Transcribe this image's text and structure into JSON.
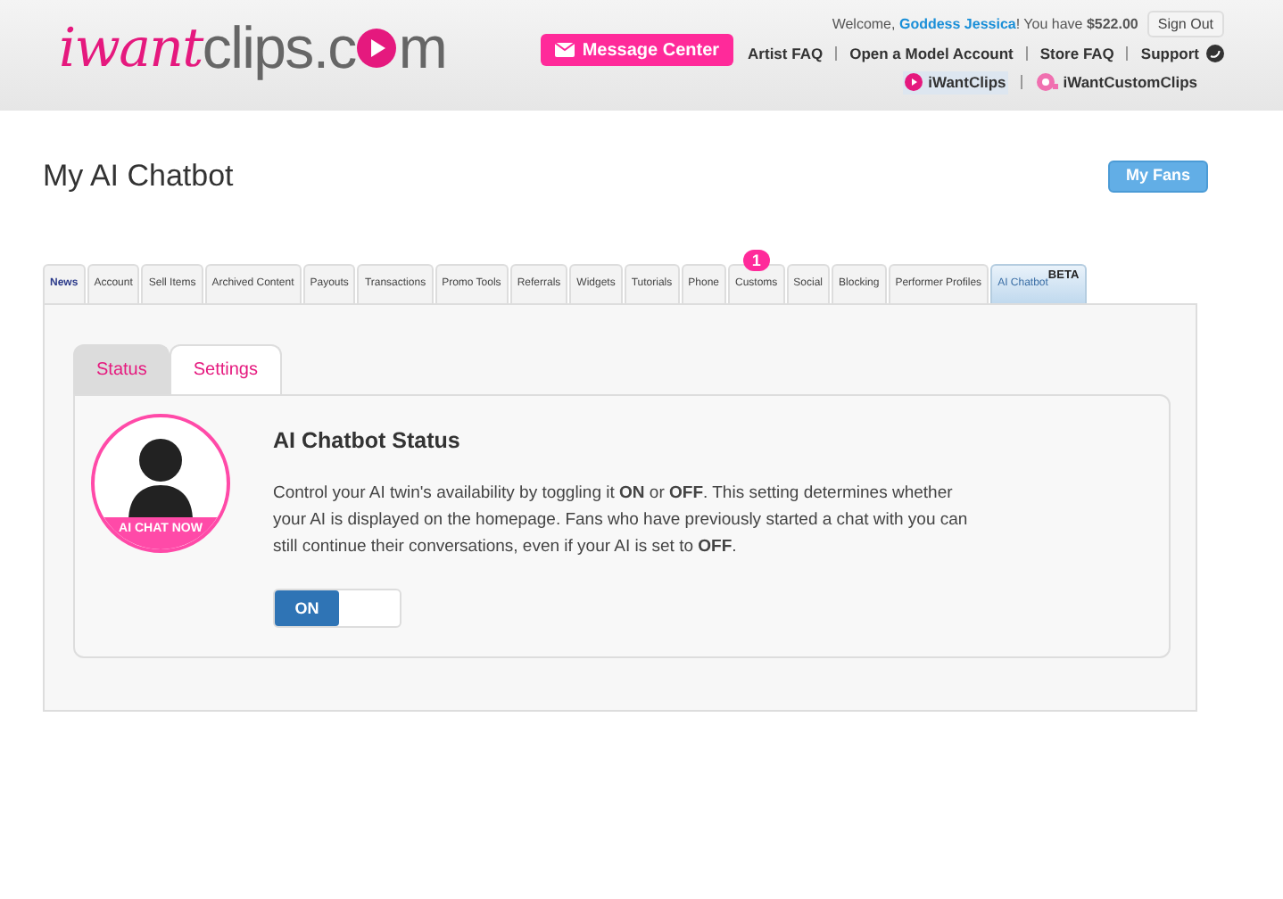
{
  "logo": {
    "part_1": "iwant",
    "part_2": "clips.c",
    "part_3": "m"
  },
  "header": {
    "message_center": "Message Center",
    "welcome_prefix": "Welcome,",
    "user_name": "Goddess Jessica",
    "welcome_suffix": "! You have **$522.00**",
    "sign_out": "Sign Out",
    "links": [
      "Artist FAQ",
      "Open a Model Account",
      "Store FAQ",
      "Support"
    ],
    "sites": [
      {
        "label": "iWantClips",
        "selected": true
      },
      {
        "label": "iWantCustomClips",
        "selected": false
      }
    ]
  },
  "page_title": "My AI Chatbot",
  "my_fans": "My Fans",
  "tabs": [
    {
      "label": "News",
      "selected": false
    },
    {
      "label": "Account",
      "selected": false
    },
    {
      "label": "Sell Items",
      "selected": false
    },
    {
      "label": "Archived Content",
      "selected": false
    },
    {
      "label": "Payouts",
      "selected": false
    },
    {
      "label": "Transactions",
      "selected": false
    },
    {
      "label": "Promo Tools",
      "selected": false
    },
    {
      "label": "Referrals",
      "selected": false
    },
    {
      "label": "Widgets",
      "selected": false
    },
    {
      "label": "Tutorials",
      "selected": false
    },
    {
      "label": "Phone",
      "selected": false
    },
    {
      "label": "Customs",
      "selected": false,
      "badge": "1"
    },
    {
      "label": "Social",
      "selected": false
    },
    {
      "label": "Blocking",
      "selected": false
    },
    {
      "label": "Performer Profiles",
      "selected": false
    },
    {
      "label": "AI Chatbot",
      "selected": true,
      "tag": "BETA"
    }
  ],
  "sub_tabs": [
    {
      "label": "Status",
      "selected": true
    },
    {
      "label": "Settings",
      "selected": false
    }
  ],
  "status_card": {
    "avatar_caption": "AI CHAT NOW",
    "heading": "AI Chatbot Status",
    "description": "Control your AI twin's availability by toggling it **ON** or **OFF**. This setting determines whether your AI is displayed on the homepage. Fans who have previously started a chat with you can still continue their conversations, even if your AI is set to **OFF**.",
    "toggle": {
      "label": "ON",
      "on": true
    }
  }
}
